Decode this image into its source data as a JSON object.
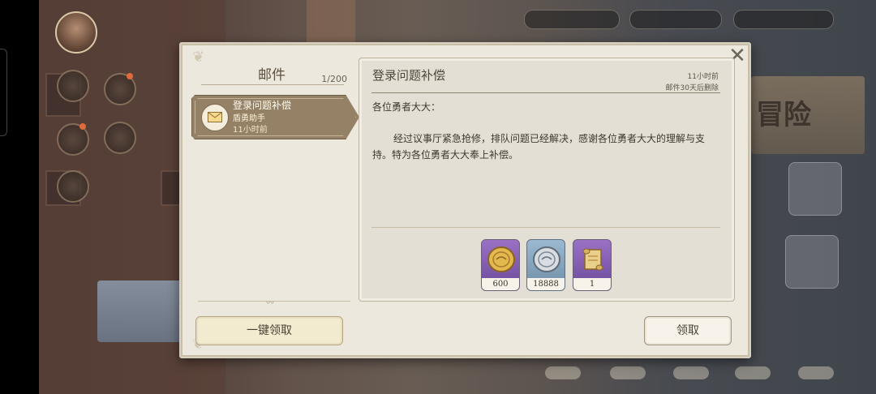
{
  "mailbox": {
    "title": "邮件",
    "count": "1/200",
    "claim_all_label": "一键领取"
  },
  "mail_list": [
    {
      "title": "登录问题补偿",
      "sender": "盾勇助手",
      "time": "11小时前",
      "icon": "envelope-icon"
    }
  ],
  "mail_detail": {
    "title": "登录问题补偿",
    "time": "11小时前",
    "expire_note": "邮件30天后删除",
    "greeting": "各位勇者大大：",
    "body": "经过议事厅紧急抢修，排队问题已经解决，感谢各位勇者大大的理解与支持。特为各位勇者大大奉上补偿。",
    "rewards": [
      {
        "icon": "gold-coin-icon",
        "quantity": "600",
        "rarity_color": "#8a62b8"
      },
      {
        "icon": "silver-coin-icon",
        "quantity": "18888",
        "rarity_color": "#8aa7bf"
      },
      {
        "icon": "scroll-icon",
        "quantity": "1",
        "rarity_color": "#8a62b8"
      }
    ],
    "claim_label": "领取"
  },
  "controls": {
    "close_icon": "close-icon"
  },
  "colors": {
    "dialog_bg": "#ece8de",
    "selected_item": "#958266",
    "claim_all_bg": "#f3ebcf"
  }
}
